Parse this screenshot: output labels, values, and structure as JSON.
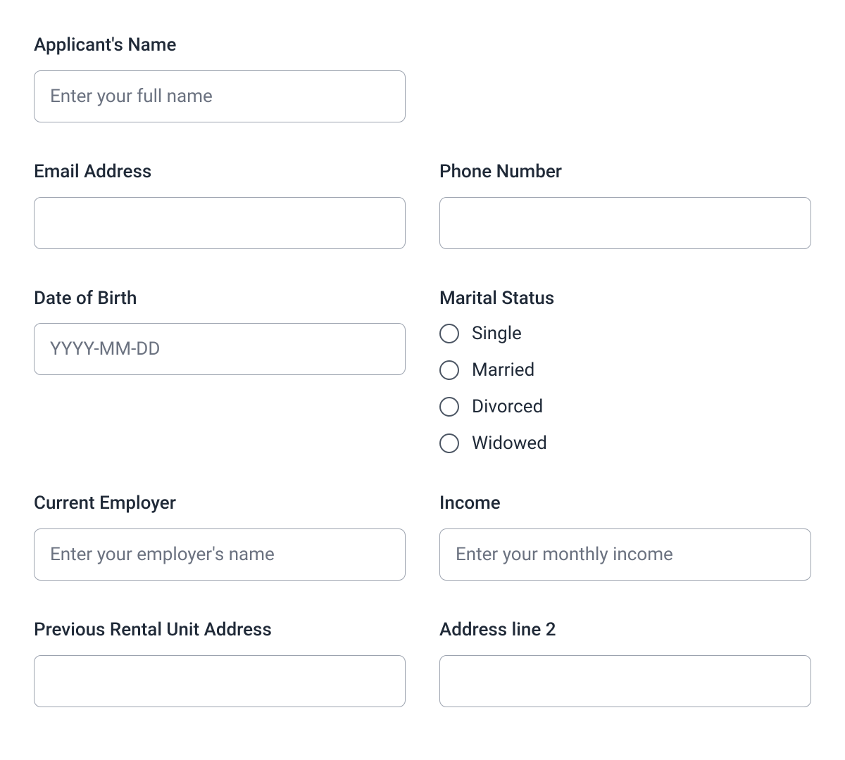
{
  "fields": {
    "name": {
      "label": "Applicant's Name",
      "placeholder": "Enter your full name"
    },
    "email": {
      "label": "Email Address",
      "placeholder": ""
    },
    "phone": {
      "label": "Phone Number",
      "placeholder": ""
    },
    "dob": {
      "label": "Date of Birth",
      "placeholder": "YYYY-MM-DD"
    },
    "marital_status": {
      "label": "Marital Status",
      "options": [
        "Single",
        "Married",
        "Divorced",
        "Widowed"
      ]
    },
    "employer": {
      "label": "Current Employer",
      "placeholder": "Enter your employer's name"
    },
    "income": {
      "label": "Income",
      "placeholder": "Enter your monthly income"
    },
    "prev_address": {
      "label": "Previous Rental Unit Address",
      "placeholder": ""
    },
    "address_line_2": {
      "label": "Address line 2",
      "placeholder": ""
    }
  }
}
